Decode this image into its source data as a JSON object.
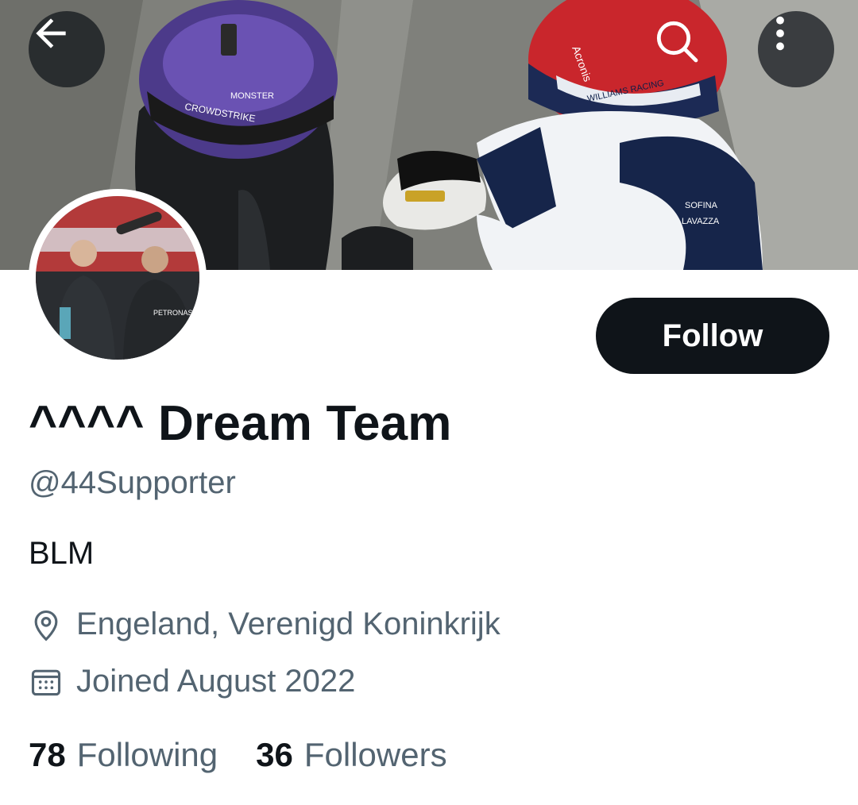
{
  "header": {
    "back_icon": "arrow-left-icon",
    "search_icon": "search-icon",
    "more_icon": "more-vertical-icon",
    "banner_image": "banner-photo-racing-drivers-handshake"
  },
  "profile": {
    "avatar_image": "avatar-photo-podium-celebration",
    "display_name": "^^^^ Dream Team",
    "handle": "@44Supporter",
    "bio": "BLM",
    "location": "Engeland, Verenigd Koninkrijk",
    "location_icon": "location-pin-icon",
    "joined": "Joined August 2022",
    "joined_icon": "calendar-icon"
  },
  "actions": {
    "follow_label": "Follow"
  },
  "stats": {
    "following_count": "78",
    "following_label": "Following",
    "followers_count": "36",
    "followers_label": "Followers"
  },
  "colors": {
    "text_primary": "#0f1419",
    "text_secondary": "#536471",
    "follow_button_bg": "#0f1419",
    "follow_button_text": "#ffffff",
    "overlay_button_bg": "#0f1419"
  }
}
